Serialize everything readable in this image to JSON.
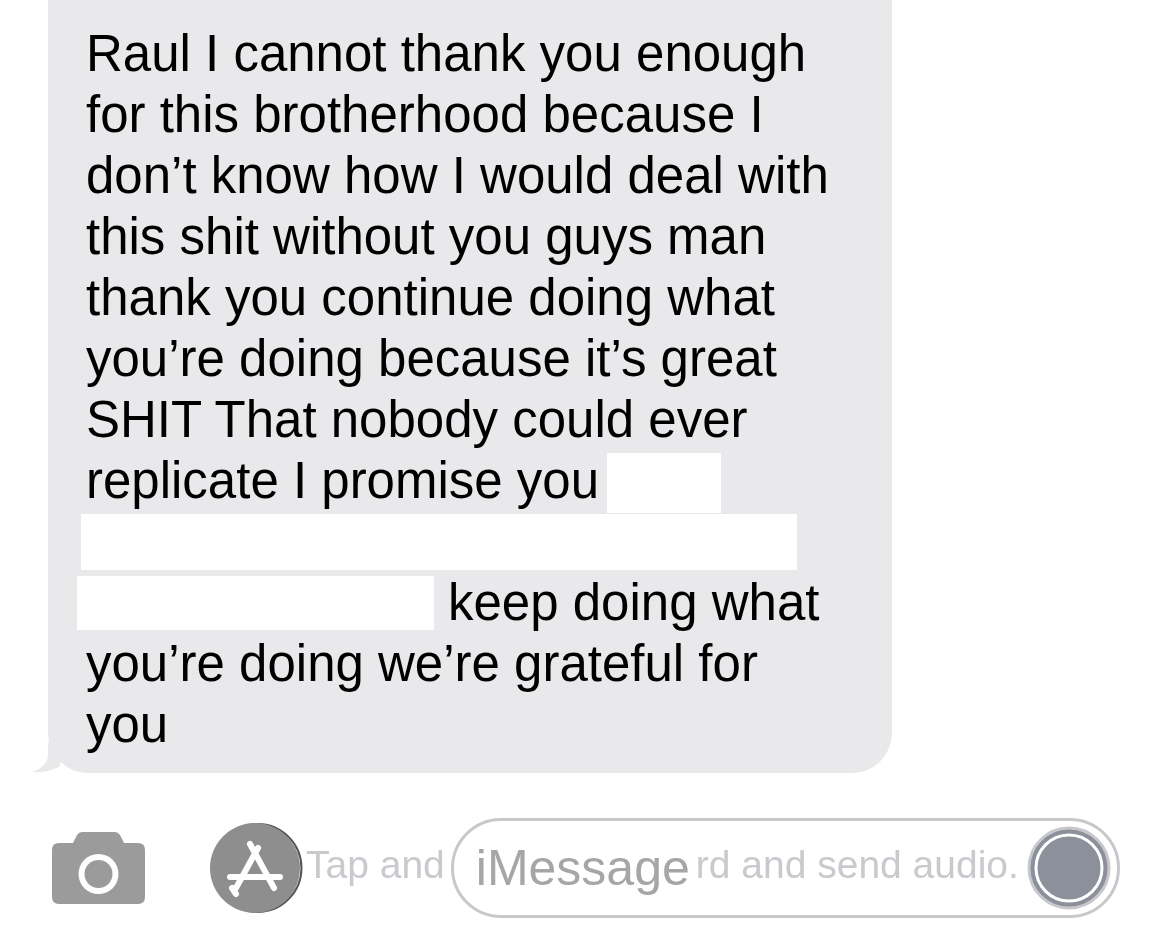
{
  "message": {
    "blocks": [
      {
        "kind": "text",
        "text": "Raul I cannot thank you enough for this brotherhood because I don’t know how I would deal with this shit without you guys man thank you continue doing what you’re doing because it’s great SHIT That nobody could ever"
      },
      {
        "kind": "line",
        "items": [
          {
            "kind": "text",
            "text": "replicate I promise you"
          },
          {
            "kind": "redaction"
          }
        ]
      },
      {
        "kind": "redaction"
      },
      {
        "kind": "line",
        "items": [
          {
            "kind": "redaction"
          },
          {
            "kind": "text",
            "text": "keep doing what"
          }
        ]
      },
      {
        "kind": "text",
        "text": "you’re doing we’re grateful for you"
      }
    ]
  },
  "composer": {
    "audio_hint_fragments": [
      "Tap and",
      "rd and send audio."
    ],
    "message_field": {
      "placeholder": "iMessage"
    }
  }
}
